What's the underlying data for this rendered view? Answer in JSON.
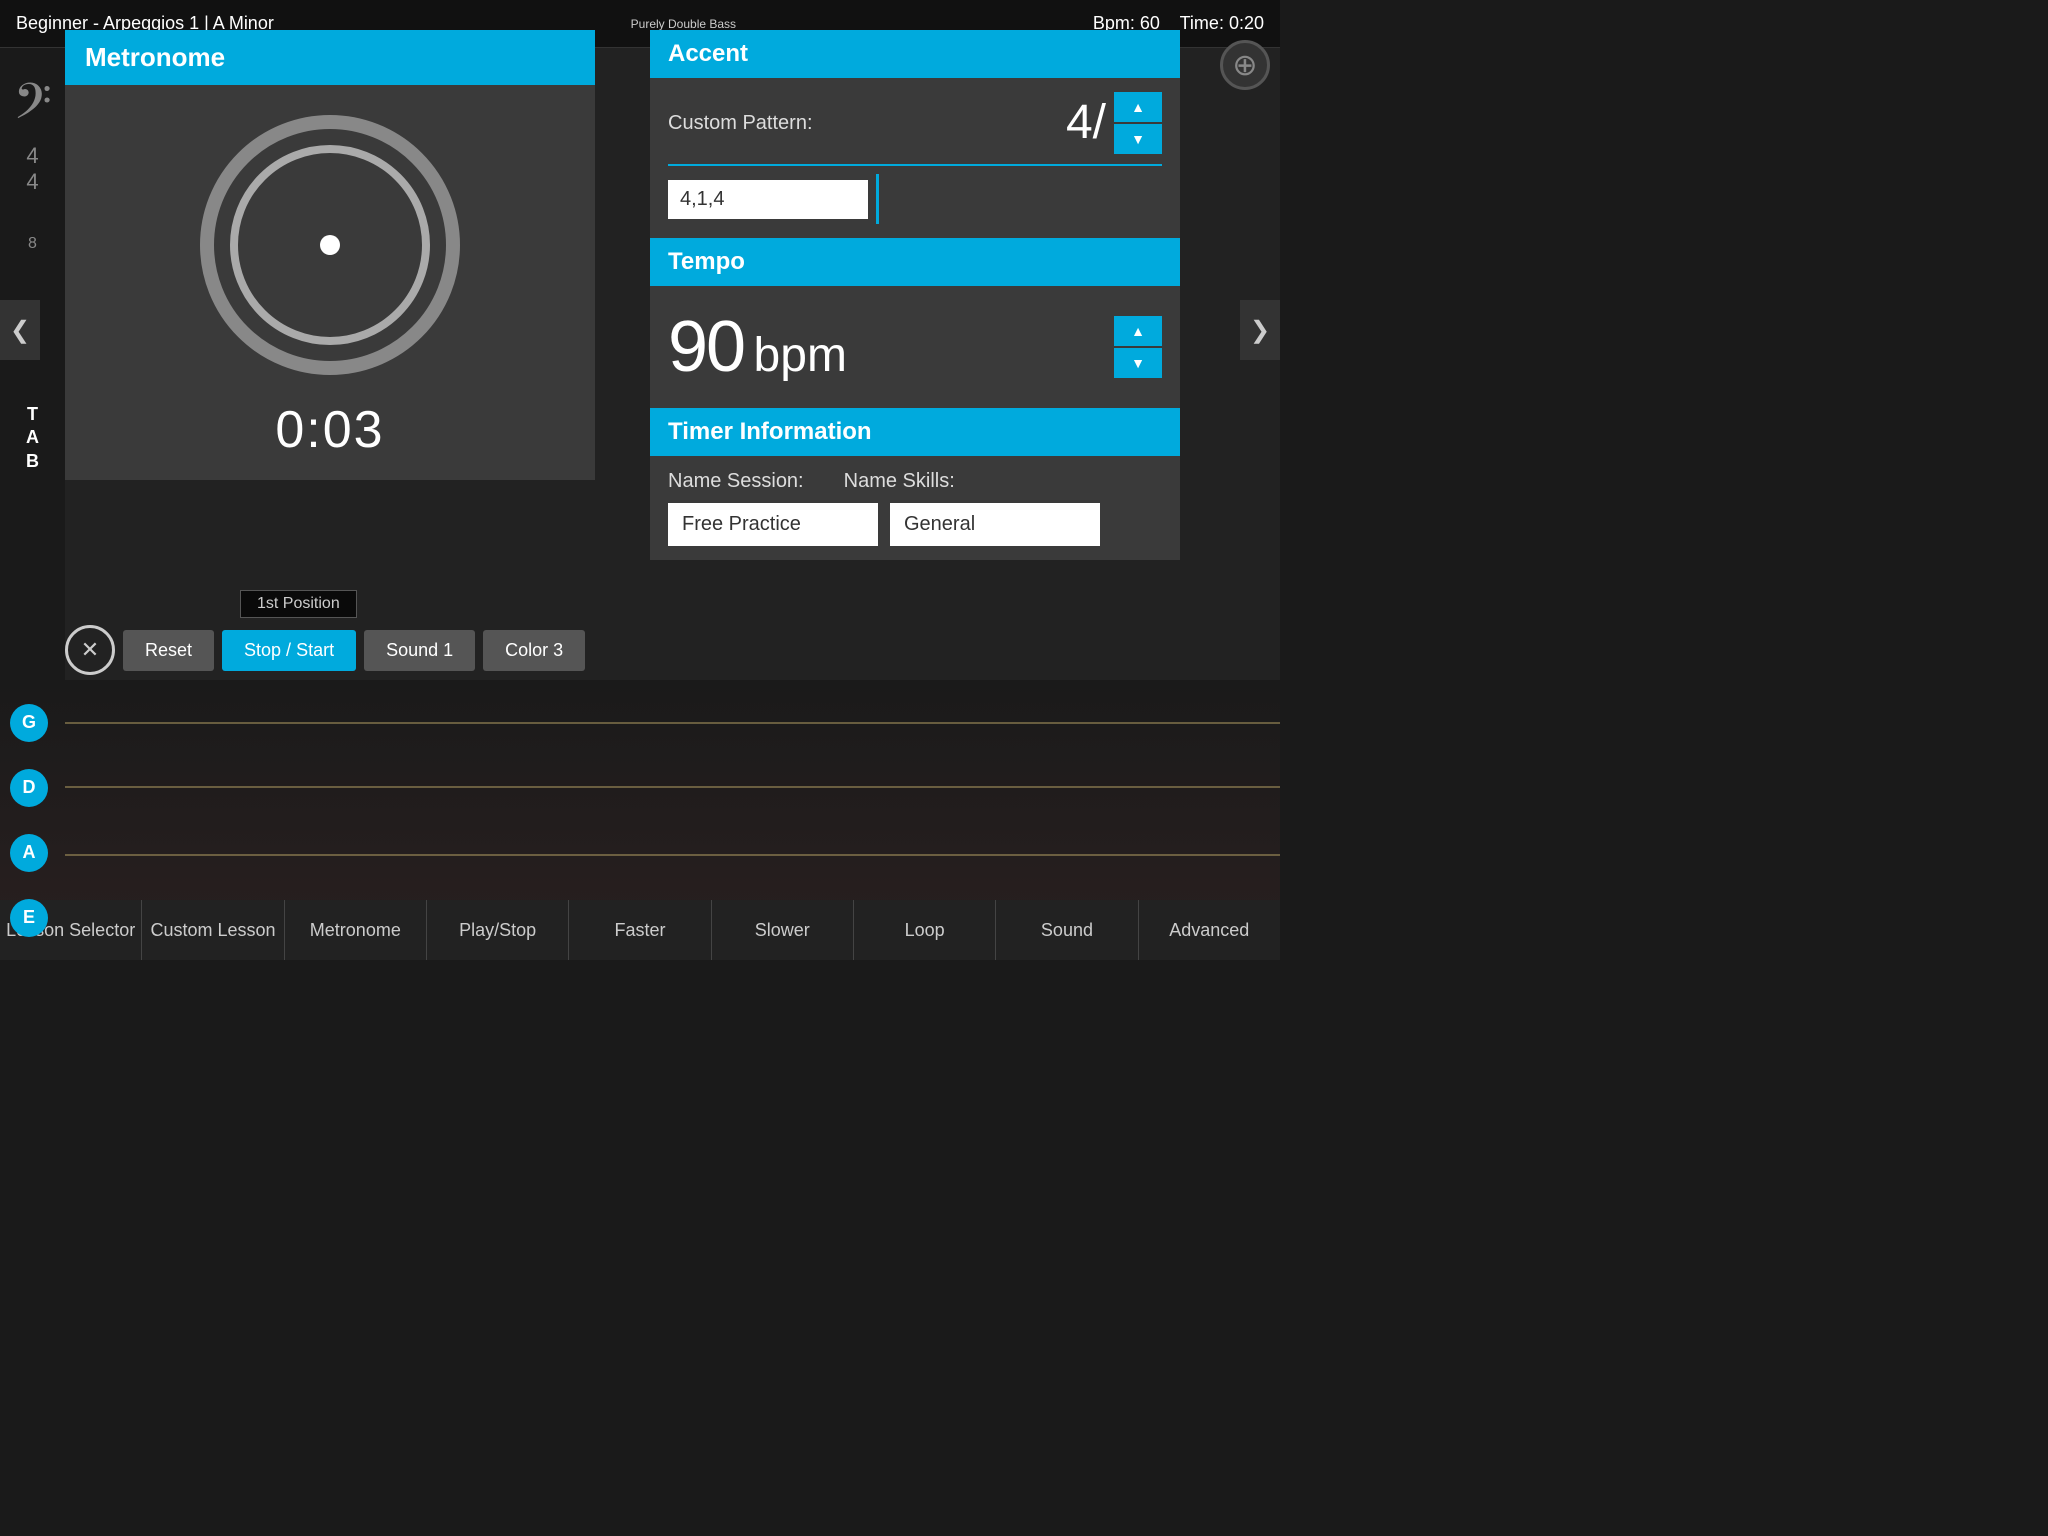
{
  "app": {
    "title": "Beginner - Arpeggios 1  |  A Minor",
    "logo": "Purely Double Bass",
    "bpm_label": "Bpm: 60",
    "time_label": "Time: 0:20"
  },
  "metronome": {
    "header": "Metronome",
    "time_display": "0:03"
  },
  "accent": {
    "header": "Accent",
    "custom_pattern_label": "Custom Pattern:",
    "pattern_value": "4,1,4",
    "big_value": "4/",
    "up_arrow": "▲",
    "down_arrow": "▼"
  },
  "tempo": {
    "header": "Tempo",
    "value": "90",
    "unit": "bpm",
    "up_arrow": "▲",
    "down_arrow": "▼"
  },
  "timer": {
    "header": "Timer Information",
    "name_session_label": "Name Session:",
    "name_skills_label": "Name Skills:",
    "session_value": "Free Practice",
    "skills_value": "General"
  },
  "controls": {
    "close_icon": "✕",
    "reset_label": "Reset",
    "stop_start_label": "Stop / Start",
    "sound_label": "Sound 1",
    "color_label": "Color 3"
  },
  "fretboard": {
    "position_label": "1st Position",
    "strings": [
      "G",
      "D",
      "A",
      "E"
    ]
  },
  "toolbar": {
    "buttons": [
      "Lesson Selector",
      "Custom Lesson",
      "Metronome",
      "Play/Stop",
      "Faster",
      "Slower",
      "Loop",
      "Sound",
      "Advanced"
    ]
  },
  "nav": {
    "left_arrow": "❮",
    "right_arrow": "❯",
    "add_icon": "⊕"
  }
}
